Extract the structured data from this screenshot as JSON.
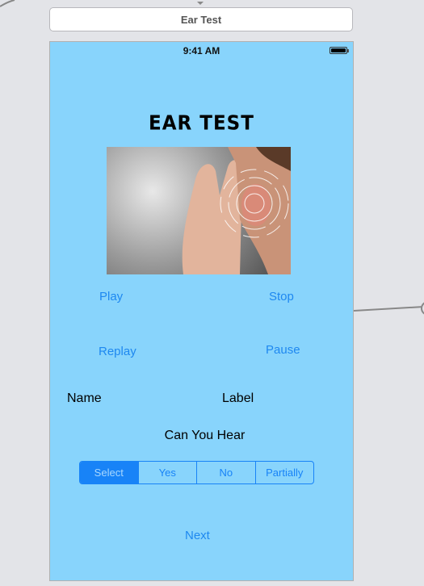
{
  "scene": {
    "title": "Ear Test"
  },
  "status_bar": {
    "time": "9:41 AM",
    "battery_icon": "battery-full-icon"
  },
  "screen": {
    "heading": "EAR TEST",
    "image_alt": "ear-listening-photo",
    "buttons": {
      "play": "Play",
      "stop": "Stop",
      "replay": "Replay",
      "pause": "Pause",
      "next": "Next"
    },
    "name_label": "Name",
    "value_label": "Label",
    "question": "Can You Hear",
    "segments": [
      "Select",
      "Yes",
      "No",
      "Partially"
    ],
    "selected_segment": "Select"
  },
  "colors": {
    "background": "#88d4fc",
    "accent": "#1883f7"
  }
}
